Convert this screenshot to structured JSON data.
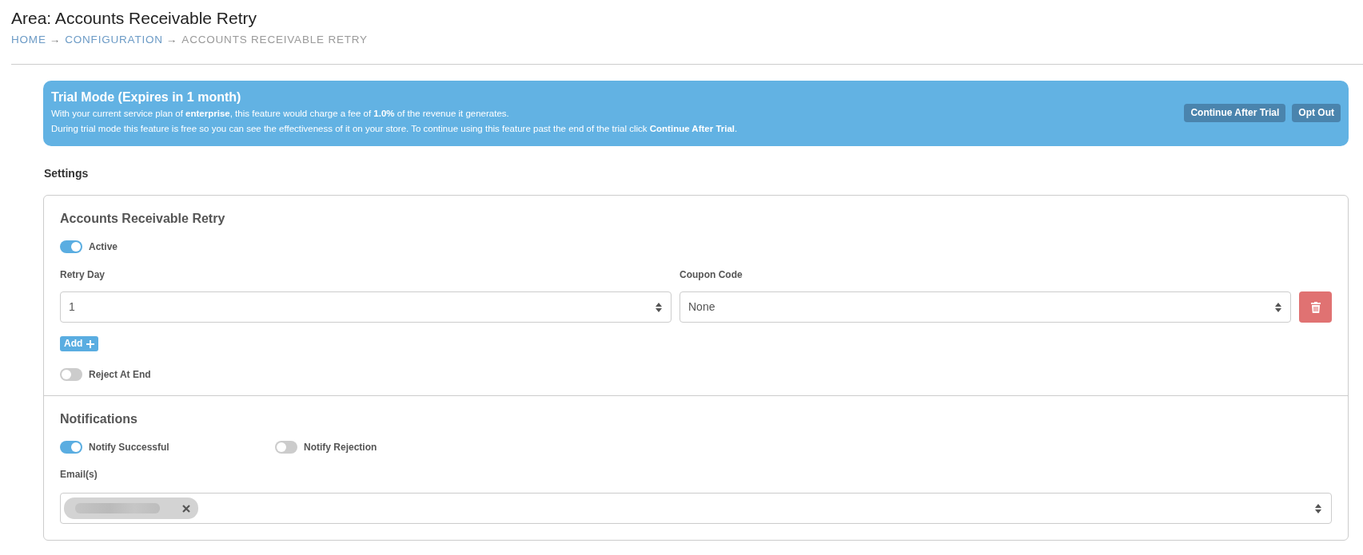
{
  "page": {
    "title": "Area: Accounts Receivable Retry"
  },
  "breadcrumb": [
    {
      "label": "HOME",
      "current": false,
      "separator": "→"
    },
    {
      "label": "CONFIGURATION",
      "current": false,
      "separator": "→"
    },
    {
      "label": "ACCOUNTS RECEIVABLE RETRY",
      "current": true
    }
  ],
  "trial_banner": {
    "title": "Trial Mode (Expires in 1 month)",
    "lines": [
      "With your current service plan of **enterprise**, this feature would charge a fee of **1.0%** of the revenue it generates.",
      "During trial mode this feature is free so you can see the effectiveness of it on your store. To continue using this feature past the end of the trial click **Continue After Trial**."
    ],
    "buttons": [
      "Continue After Trial",
      "Opt Out"
    ]
  },
  "section_label": "Settings",
  "settings_card": {
    "title": "Accounts Receivable Retry",
    "active_toggle": {
      "label": "Active",
      "on": true
    },
    "retry_rows": [
      {
        "retry_day": {
          "label": "Retry Day",
          "value": "1"
        },
        "coupon_code": {
          "label": "Coupon Code",
          "value": "None"
        }
      }
    ],
    "add_button": "Add",
    "reject_toggle": {
      "label": "Reject At End",
      "on": false
    }
  },
  "notifications": {
    "title": "Notifications",
    "toggles": [
      {
        "label": "Notify Successful",
        "on": true
      },
      {
        "label": "Notify Rejection",
        "on": false
      }
    ],
    "emails_label": "Email(s)",
    "emails": [
      {
        "redacted": true
      }
    ]
  }
}
